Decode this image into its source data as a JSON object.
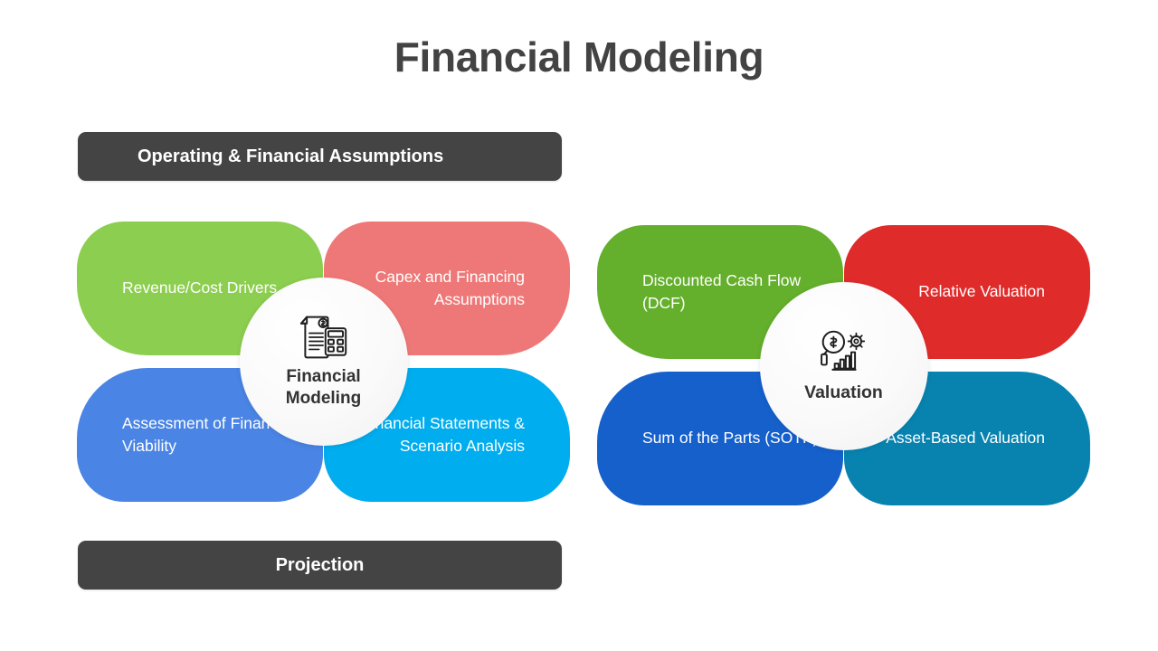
{
  "page": {
    "title": "Financial Modeling",
    "background_color": "#ffffff"
  },
  "banners": {
    "top": {
      "label": "Operating & Financial Assumptions",
      "color": "#444444",
      "text_color": "#ffffff"
    },
    "bottom": {
      "label": "Projection",
      "color": "#444444",
      "text_color": "#ffffff"
    }
  },
  "clusters": [
    {
      "id": "financial-modeling",
      "hub": {
        "label": "Financial Modeling",
        "icon": "document-calculator-icon",
        "background_color": "#fafafa",
        "text_color": "#333333"
      },
      "petals": [
        {
          "position": "top-left",
          "label": "Revenue/Cost Drivers",
          "color": "#8CCE4F"
        },
        {
          "position": "top-right",
          "label": "Capex and Financing Assumptions",
          "color": "#EE7878"
        },
        {
          "position": "bottom-left",
          "label": "Assessment of Financial Viability",
          "color": "#4A84E4"
        },
        {
          "position": "bottom-right",
          "label": "Financial Statements & Scenario Analysis",
          "color": "#00ADEE"
        }
      ]
    },
    {
      "id": "valuation",
      "hub": {
        "label": "Valuation",
        "icon": "magnifier-gear-chart-icon",
        "background_color": "#fafafa",
        "text_color": "#333333"
      },
      "petals": [
        {
          "position": "top-left",
          "label": "Discounted Cash Flow (DCF)",
          "color": "#64AF2C"
        },
        {
          "position": "top-right",
          "label": "Relative Valuation",
          "color": "#E02B2B"
        },
        {
          "position": "bottom-left",
          "label": "Sum of the Parts (SOTP)",
          "color": "#1660CB"
        },
        {
          "position": "bottom-right",
          "label": "Asset-Based Valuation",
          "color": "#0883B0"
        }
      ]
    }
  ]
}
